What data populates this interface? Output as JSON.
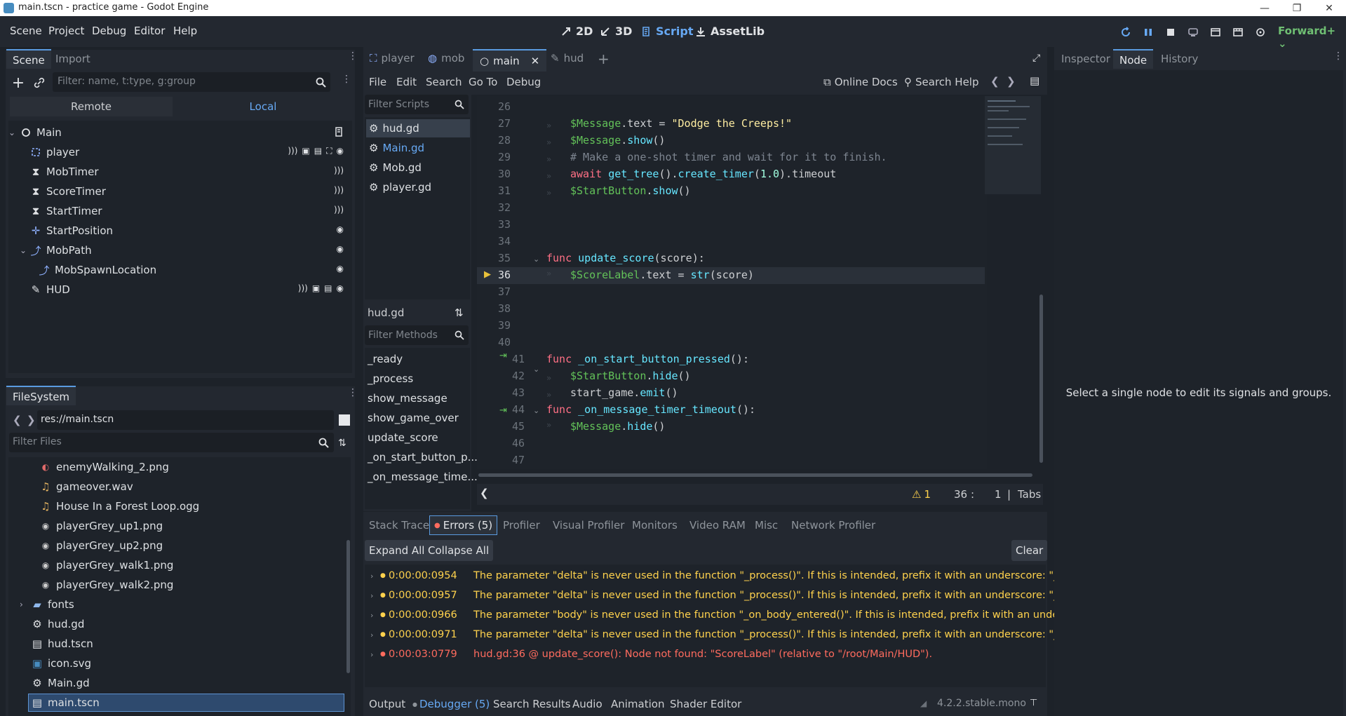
{
  "window": {
    "title": "main.tscn - practice game - Godot Engine"
  },
  "menu": [
    "Scene",
    "Project",
    "Debug",
    "Editor",
    "Help"
  ],
  "workspaces": [
    {
      "label": "2D",
      "icon": "2d-icon",
      "active": false
    },
    {
      "label": "3D",
      "icon": "3d-icon",
      "active": false
    },
    {
      "label": "Script",
      "icon": "script-icon",
      "active": true
    },
    {
      "label": "AssetLib",
      "icon": "assetlib-icon",
      "active": false
    }
  ],
  "renderer": "Forward+",
  "scene_dock": {
    "tabs": [
      "Scene",
      "Import"
    ],
    "filter_placeholder": "Filter: name, t:type, g:group",
    "remote_label": "Remote",
    "local_label": "Local",
    "nodes": [
      {
        "name": "Main",
        "icon": "node2d-icon"
      },
      {
        "name": "player",
        "icon": "area2d-icon"
      },
      {
        "name": "MobTimer",
        "icon": "timer-icon"
      },
      {
        "name": "ScoreTimer",
        "icon": "timer-icon"
      },
      {
        "name": "StartTimer",
        "icon": "timer-icon"
      },
      {
        "name": "StartPosition",
        "icon": "marker-icon"
      },
      {
        "name": "MobPath",
        "icon": "path-icon"
      },
      {
        "name": "MobSpawnLocation",
        "icon": "pathfollow-icon"
      },
      {
        "name": "HUD",
        "icon": "canvaslayer-icon"
      }
    ]
  },
  "filesystem": {
    "tab": "FileSystem",
    "path": "res://main.tscn",
    "filter_placeholder": "Filter Files",
    "files": [
      {
        "name": "enemyWalking_2.png",
        "icon": "image-icon"
      },
      {
        "name": "gameover.wav",
        "icon": "audio-icon"
      },
      {
        "name": "House In a Forest Loop.ogg",
        "icon": "audio-icon"
      },
      {
        "name": "playerGrey_up1.png",
        "icon": "image-icon"
      },
      {
        "name": "playerGrey_up2.png",
        "icon": "image-icon"
      },
      {
        "name": "playerGrey_walk1.png",
        "icon": "image-icon"
      },
      {
        "name": "playerGrey_walk2.png",
        "icon": "image-icon"
      },
      {
        "name": "fonts",
        "icon": "folder-icon"
      },
      {
        "name": "hud.gd",
        "icon": "gear-icon"
      },
      {
        "name": "hud.tscn",
        "icon": "scene-icon"
      },
      {
        "name": "icon.svg",
        "icon": "svg-icon"
      },
      {
        "name": "Main.gd",
        "icon": "gear-icon"
      },
      {
        "name": "main.tscn",
        "icon": "scene-icon"
      }
    ]
  },
  "editor_tabs": [
    {
      "label": "player",
      "icon": "area2d-icon"
    },
    {
      "label": "mob",
      "icon": "rigidbody-icon"
    },
    {
      "label": "main",
      "icon": "node2d-icon"
    },
    {
      "label": "hud",
      "icon": "canvaslayer-icon"
    }
  ],
  "script_menu": [
    "File",
    "Edit",
    "Search",
    "Go To",
    "Debug"
  ],
  "online_docs": "Online Docs",
  "search_help": "Search Help",
  "filter_scripts_placeholder": "Filter Scripts",
  "scripts": [
    "hud.gd",
    "Main.gd",
    "Mob.gd",
    "player.gd"
  ],
  "current_script": "hud.gd",
  "filter_methods_placeholder": "Filter Methods",
  "methods": [
    "_ready",
    "_process",
    "show_message",
    "show_game_over",
    "update_score",
    "_on_start_button_p...",
    "_on_message_time..."
  ],
  "code_lines": [
    "26",
    "27",
    "28",
    "29",
    "30",
    "31",
    "32",
    "33",
    "34",
    "35",
    "36",
    "37",
    "38",
    "39",
    "40",
    "41",
    "42",
    "43",
    "44",
    "45",
    "46",
    "47"
  ],
  "status": {
    "warnings": "1",
    "line": "36",
    "col": "1",
    "indent": "Tabs"
  },
  "debugger_tabs": [
    "Stack Trace",
    "Errors (5)",
    "Profiler",
    "Visual Profiler",
    "Monitors",
    "Video RAM",
    "Misc",
    "Network Profiler"
  ],
  "expand_all": "Expand All",
  "collapse_all": "Collapse All",
  "clear": "Clear",
  "errors": [
    {
      "time": "0:00:00:0954",
      "msg": "The parameter \"delta\" is never used in the function \"_process()\". If this is intended, prefix it with an underscore: \"_delta\".",
      "kind": "warning"
    },
    {
      "time": "0:00:00:0957",
      "msg": "The parameter \"delta\" is never used in the function \"_process()\". If this is intended, prefix it with an underscore: \"_delta\".",
      "kind": "warning"
    },
    {
      "time": "0:00:00:0966",
      "msg": "The parameter \"body\" is never used in the function \"_on_body_entered()\". If this is intended, prefix it with an underscore: ...",
      "kind": "warning"
    },
    {
      "time": "0:00:00:0971",
      "msg": "The parameter \"delta\" is never used in the function \"_process()\". If this is intended, prefix it with an underscore: \"_delta\".",
      "kind": "warning"
    },
    {
      "time": "0:00:03:0779",
      "msg": "hud.gd:36 @ update_score(): Node not found: \"ScoreLabel\" (relative to \"/root/Main/HUD\").",
      "kind": "error"
    }
  ],
  "bottom_tabs": [
    "Output",
    "Debugger (5)",
    "Search Results",
    "Audio",
    "Animation",
    "Shader Editor"
  ],
  "version": "4.2.2.stable.mono",
  "inspector": {
    "tabs": [
      "Inspector",
      "Node",
      "History"
    ],
    "message": "Select a single node to edit its signals and groups."
  },
  "colors": {
    "accent": "#67a9f4",
    "warning": "#ffd24d",
    "error": "#ff6b5e",
    "renderer": "#6fbf73"
  }
}
